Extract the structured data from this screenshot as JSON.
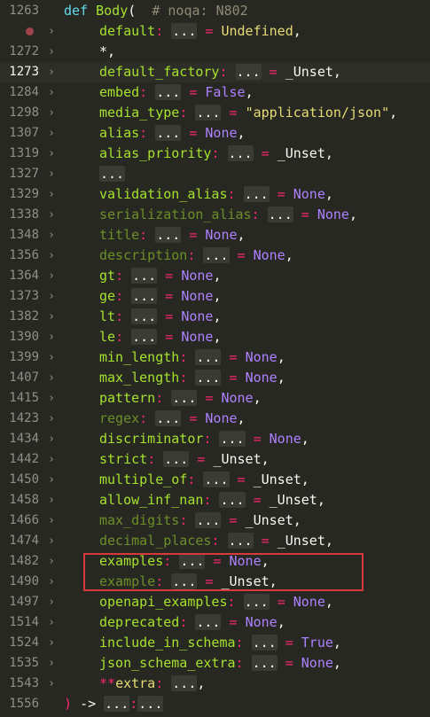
{
  "theme": {
    "background": "#272822",
    "highlight_box": "#d63a3a",
    "breakpoint": "#a0424a"
  },
  "editor": {
    "lines": [
      {
        "num": "1263",
        "kind": "def",
        "def_kw": "def",
        "fn": "Body",
        "paren": "(",
        "comment": "# noqa: N802"
      },
      {
        "num": "",
        "kind": "param",
        "name": "default",
        "value": "Undefined",
        "vclass": "un",
        "breakpoint": true
      },
      {
        "num": "1272",
        "kind": "star",
        "text": "*,"
      },
      {
        "num": "1273",
        "kind": "param",
        "name": "default_factory",
        "value": "_Unset",
        "vclass": "pl",
        "current": true
      },
      {
        "num": "1284",
        "kind": "param",
        "name": "embed",
        "value": "False",
        "vclass": "cn"
      },
      {
        "num": "1298",
        "kind": "param",
        "name": "media_type",
        "value": "\"application/json\"",
        "vclass": "str"
      },
      {
        "num": "1307",
        "kind": "param",
        "name": "alias",
        "value": "None",
        "vclass": "cn"
      },
      {
        "num": "1319",
        "kind": "param",
        "name": "alias_priority",
        "value": "_Unset",
        "vclass": "pl"
      },
      {
        "num": "1327",
        "kind": "ellipsis",
        "text": "..."
      },
      {
        "num": "1329",
        "kind": "param",
        "name": "validation_alias",
        "value": "None",
        "vclass": "cn"
      },
      {
        "num": "1338",
        "kind": "param",
        "name": "serialization_alias",
        "value": "None",
        "vclass": "cn",
        "dim": true
      },
      {
        "num": "1348",
        "kind": "param",
        "name": "title",
        "value": "None",
        "vclass": "cn",
        "dim": true
      },
      {
        "num": "1356",
        "kind": "param",
        "name": "description",
        "value": "None",
        "vclass": "cn",
        "dim": true
      },
      {
        "num": "1364",
        "kind": "param",
        "name": "gt",
        "value": "None",
        "vclass": "cn"
      },
      {
        "num": "1373",
        "kind": "param",
        "name": "ge",
        "value": "None",
        "vclass": "cn"
      },
      {
        "num": "1382",
        "kind": "param",
        "name": "lt",
        "value": "None",
        "vclass": "cn"
      },
      {
        "num": "1390",
        "kind": "param",
        "name": "le",
        "value": "None",
        "vclass": "cn"
      },
      {
        "num": "1399",
        "kind": "param",
        "name": "min_length",
        "value": "None",
        "vclass": "cn"
      },
      {
        "num": "1407",
        "kind": "param",
        "name": "max_length",
        "value": "None",
        "vclass": "cn"
      },
      {
        "num": "1415",
        "kind": "param",
        "name": "pattern",
        "value": "None",
        "vclass": "cn"
      },
      {
        "num": "1423",
        "kind": "param",
        "name": "regex",
        "value": "None",
        "vclass": "cn",
        "dim": true
      },
      {
        "num": "1434",
        "kind": "param",
        "name": "discriminator",
        "value": "None",
        "vclass": "cn"
      },
      {
        "num": "1442",
        "kind": "param",
        "name": "strict",
        "value": "_Unset",
        "vclass": "pl"
      },
      {
        "num": "1450",
        "kind": "param",
        "name": "multiple_of",
        "value": "_Unset",
        "vclass": "pl"
      },
      {
        "num": "1458",
        "kind": "param",
        "name": "allow_inf_nan",
        "value": "_Unset",
        "vclass": "pl"
      },
      {
        "num": "1466",
        "kind": "param",
        "name": "max_digits",
        "value": "_Unset",
        "vclass": "pl",
        "dim": true
      },
      {
        "num": "1474",
        "kind": "param",
        "name": "decimal_places",
        "value": "_Unset",
        "vclass": "pl",
        "dim": true
      },
      {
        "num": "1482",
        "kind": "param",
        "name": "examples",
        "value": "None",
        "vclass": "cn"
      },
      {
        "num": "1490",
        "kind": "param",
        "name": "example",
        "value": "_Unset",
        "vclass": "pl",
        "dim": true
      },
      {
        "num": "1497",
        "kind": "param",
        "name": "openapi_examples",
        "value": "None",
        "vclass": "cn"
      },
      {
        "num": "1514",
        "kind": "param",
        "name": "deprecated",
        "value": "None",
        "vclass": "cn"
      },
      {
        "num": "1524",
        "kind": "param",
        "name": "include_in_schema",
        "value": "True",
        "vclass": "cn"
      },
      {
        "num": "1535",
        "kind": "param",
        "name": "json_schema_extra",
        "value": "None",
        "vclass": "cn"
      },
      {
        "num": "1543",
        "kind": "kwargs",
        "stars": "**",
        "name": "extra",
        "value": "..."
      },
      {
        "num": "1556",
        "kind": "close",
        "paren": ")",
        "arrow": "->",
        "ret": "...",
        "colon": ":",
        "tail": "..."
      }
    ],
    "tokens": {
      "colon": ":",
      "ellipsis": "...",
      "eq": "=",
      "comma": ",",
      "fold_icon": "›"
    }
  }
}
